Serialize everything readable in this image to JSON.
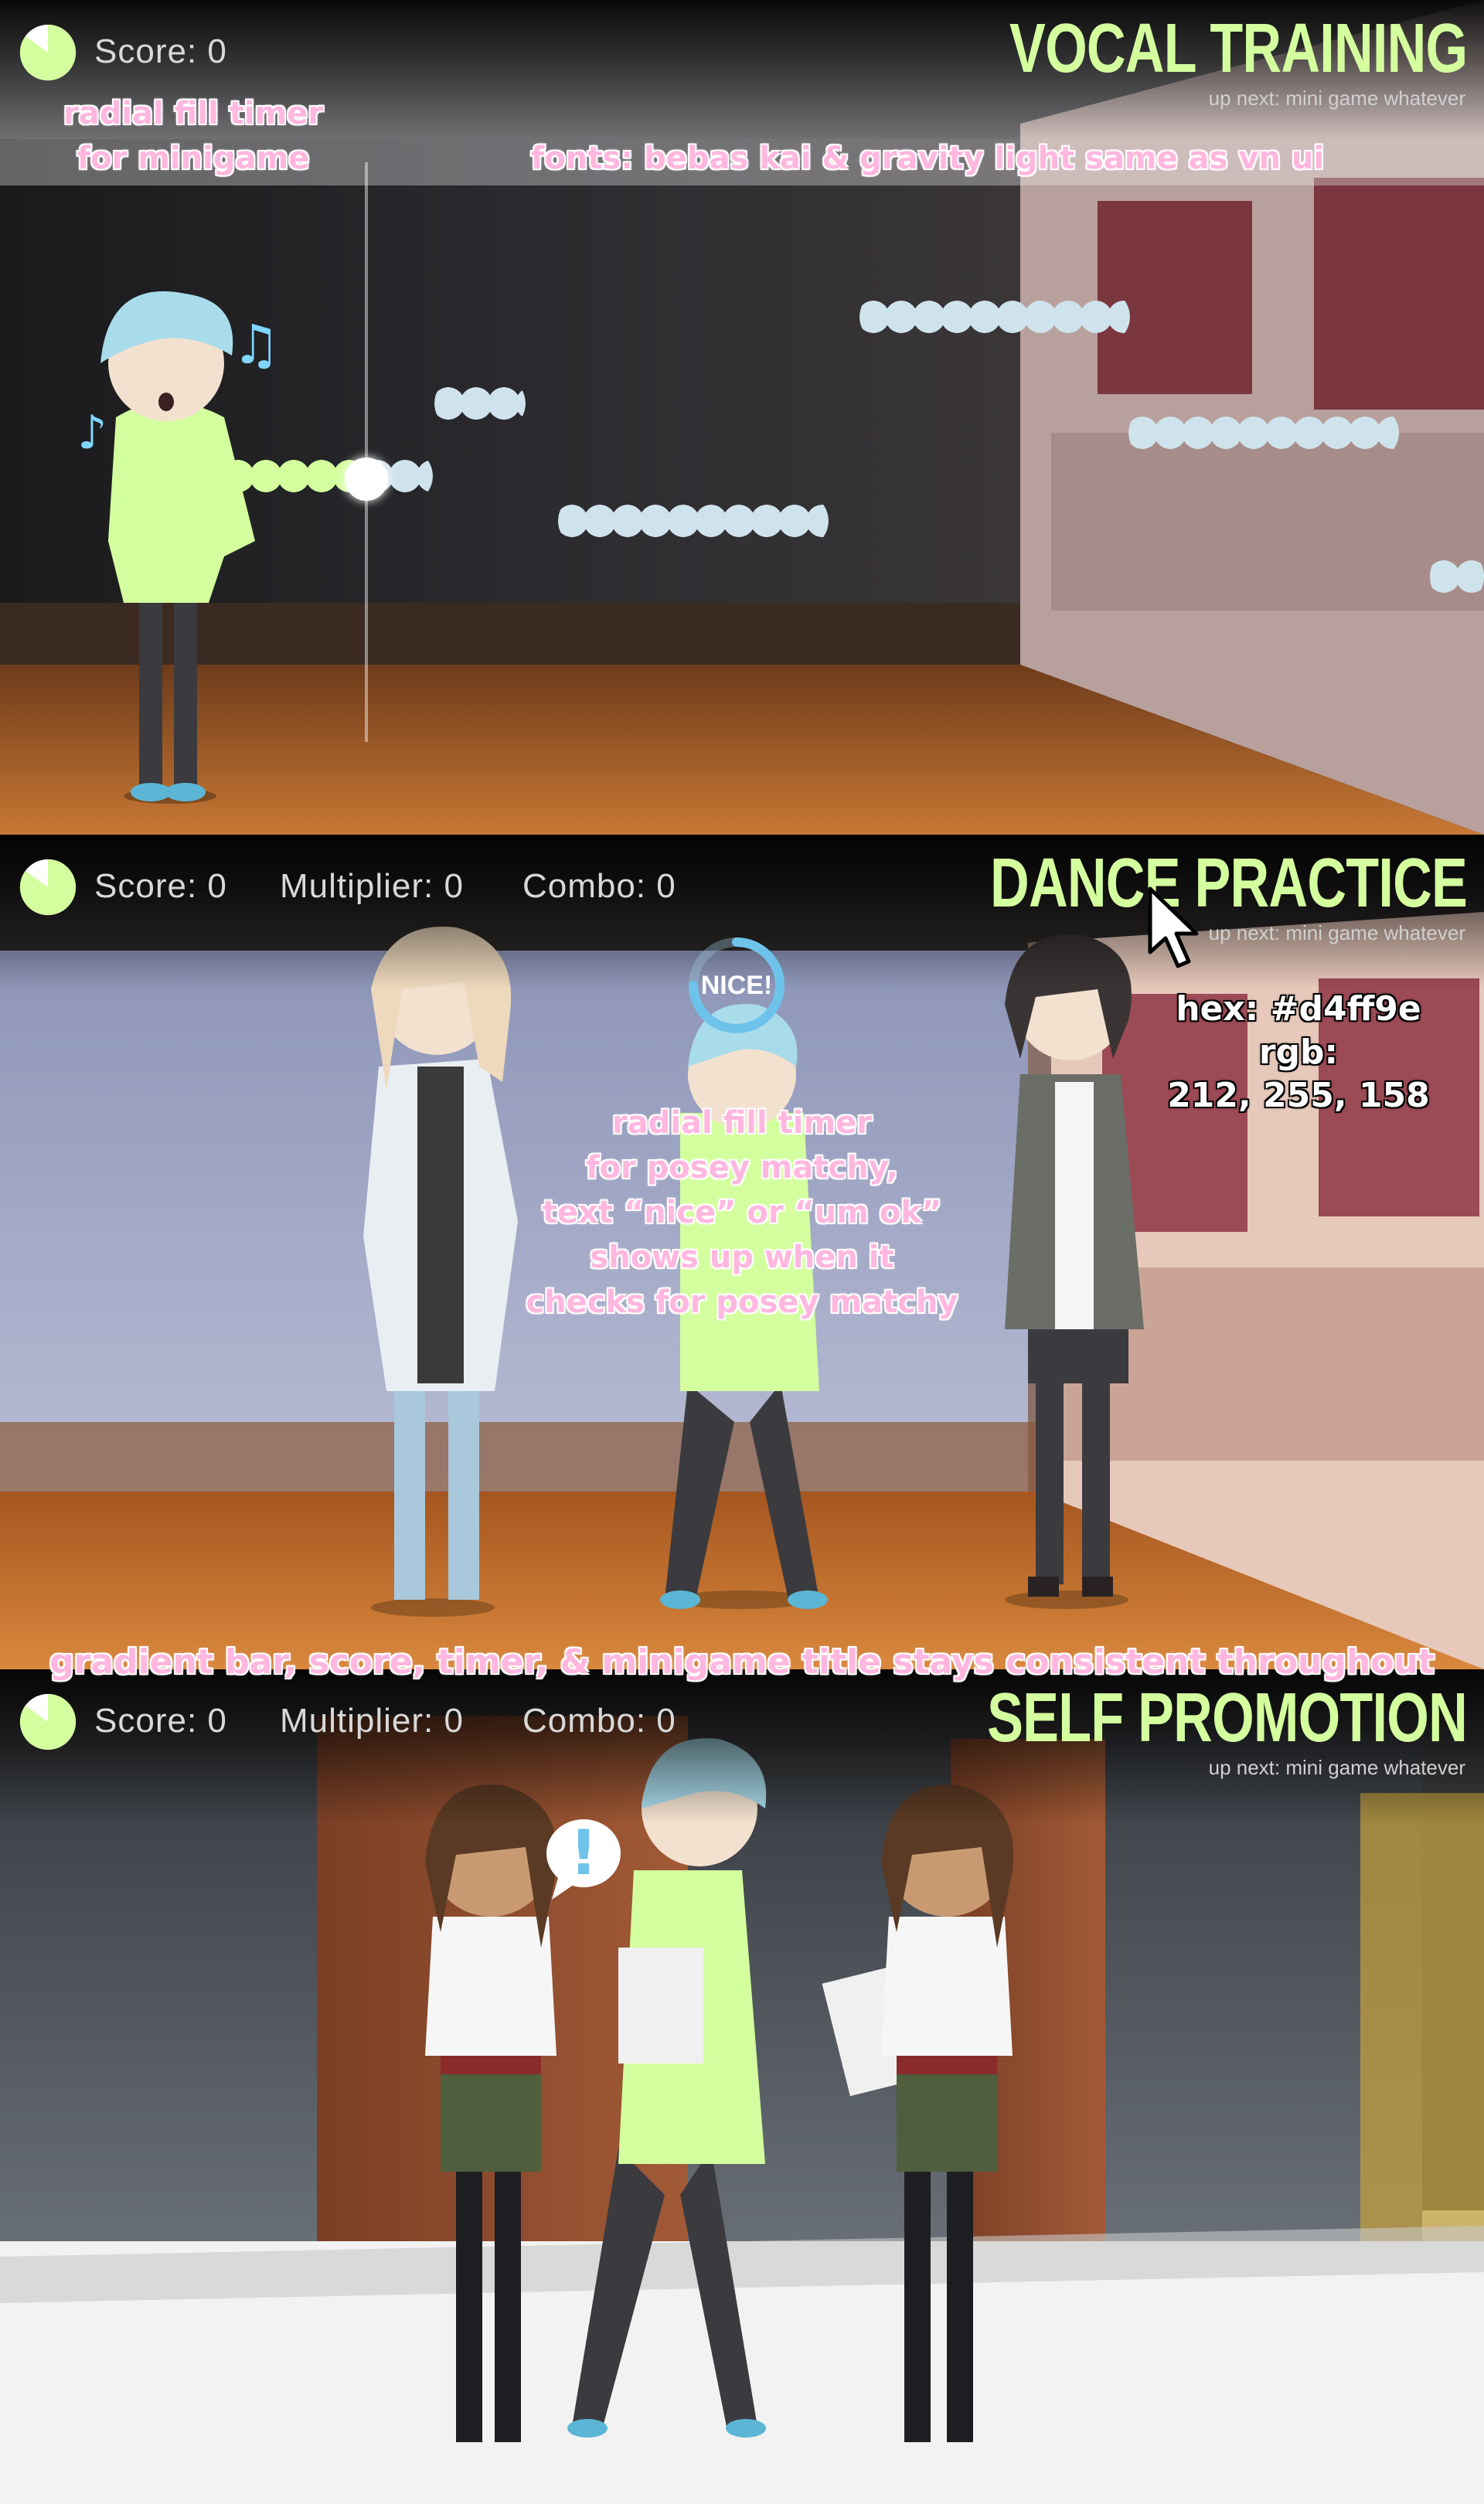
{
  "colors": {
    "accent": "#d4ff9e",
    "annotation": "#ffb7df",
    "hud_text": "#d8d8d8",
    "note_block": "#c8dfe9"
  },
  "panels": [
    {
      "title": "VOCAL TRAINING",
      "subtitle": "up next: mini game whatever",
      "score": "Score: 0",
      "timer_fill": 0.85
    },
    {
      "title": "DANCE PRACTICE",
      "subtitle": "up next: mini game whatever",
      "score": "Score: 0",
      "multiplier": "Multiplier: 0",
      "combo": "Combo: 0",
      "timer_fill": 0.85,
      "badge_text": "NICE!",
      "badge_fill": 0.75
    },
    {
      "title": "SELF PROMOTION",
      "subtitle": "up next: mini game whatever",
      "score": "Score: 0",
      "multiplier": "Multiplier: 0",
      "combo": "Combo: 0",
      "timer_fill": 0.85,
      "speech_icon": "exclamation-icon"
    }
  ],
  "annotations": {
    "timer_note": "radial fill timer\nfor minigame",
    "fonts_note": "fonts: bebas kai & gravity light same as vn ui",
    "dance_note": "radial fill timer\nfor posey matchy,\ntext “nice” or “um ok”\nshows up when it\nchecks for posey matchy",
    "color_note": "hex: #d4ff9e\nrgb:\n212, 255, 158",
    "consistency_note": "gradient bar, score, timer, & minigame title stays consistent throughout"
  }
}
